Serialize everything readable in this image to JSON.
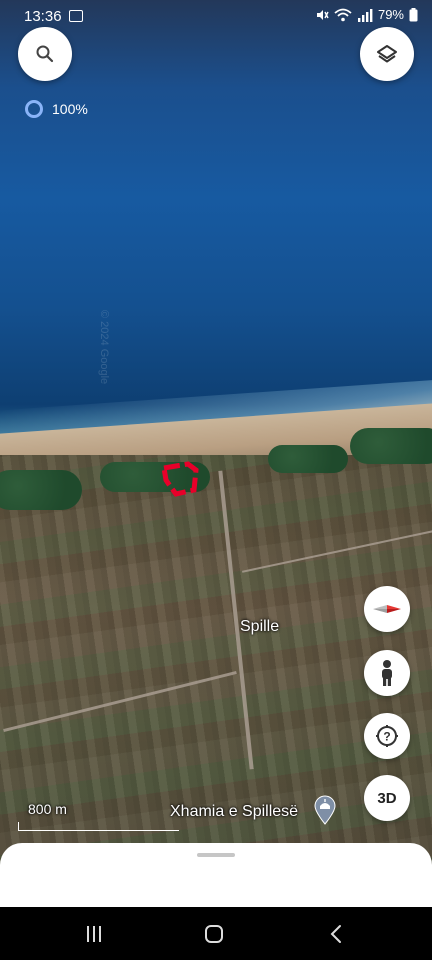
{
  "status_bar": {
    "time": "13:36",
    "battery": "79%",
    "icons": [
      "gallery-icon",
      "mute-icon",
      "wifi-icon",
      "signal-icon",
      "battery-icon"
    ]
  },
  "map": {
    "load_progress": "100%",
    "place_label": "Spille",
    "poi_label": "Xhamia e Spillesë",
    "scale_label": "800 m",
    "watermark": "© 2024 Google",
    "feature_color": "#e8002a"
  },
  "controls": {
    "three_d_label": "3D",
    "icons": [
      "search-icon",
      "layers-icon",
      "compass-icon",
      "pegman-icon",
      "help-icon"
    ]
  },
  "nav": {
    "icons": [
      "recents-icon",
      "home-icon",
      "back-icon"
    ]
  },
  "colors": {
    "accent": "#8ab4f8",
    "button_bg": "#ffffff"
  }
}
